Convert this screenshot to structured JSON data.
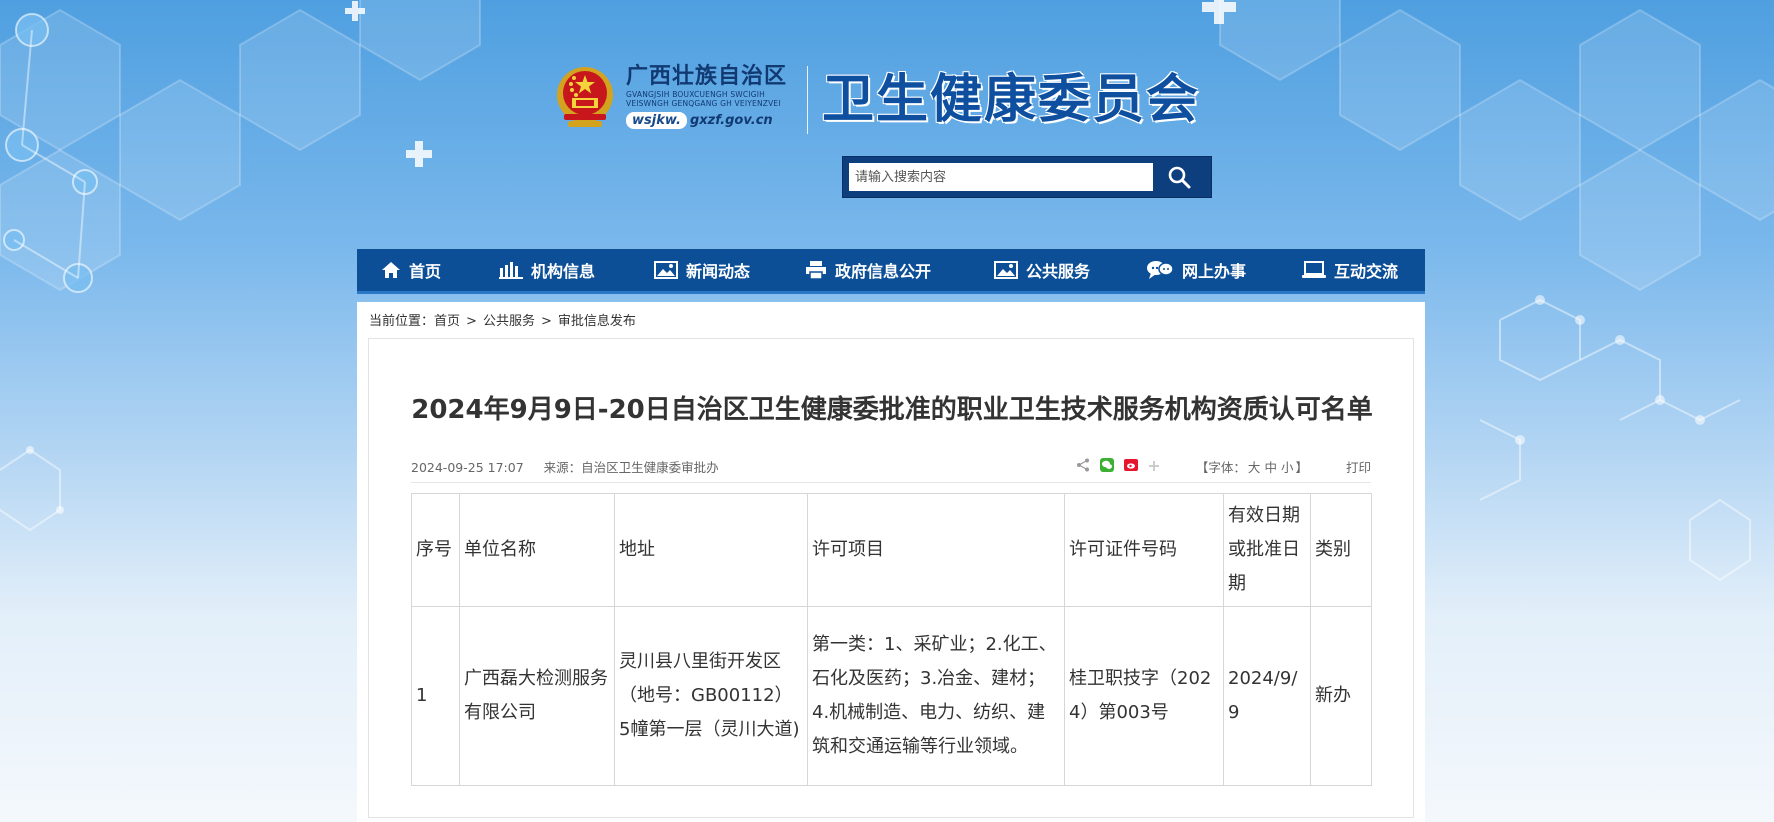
{
  "header": {
    "region_name": "广西壮族自治区",
    "region_name_latin_1": "GVANGJSIH BOUXCUENGH SWCIGIH",
    "region_name_latin_2": "VEISWNGH GENQGANG GH VEIYENZVEI",
    "domain_prefix": "wsjkw.",
    "domain_rest": "gxzf.gov.cn",
    "site_title": "卫生健康委员会"
  },
  "search": {
    "placeholder": "请输入搜索内容",
    "icon": "search-icon"
  },
  "nav": {
    "items": [
      {
        "label": "首页",
        "icon": "home-icon"
      },
      {
        "label": "机构信息",
        "icon": "bar-chart-icon"
      },
      {
        "label": "新闻动态",
        "icon": "image-icon"
      },
      {
        "label": "政府信息公开",
        "icon": "printer-icon"
      },
      {
        "label": "公共服务",
        "icon": "image-icon"
      },
      {
        "label": "网上办事",
        "icon": "chat-bubbles-icon"
      },
      {
        "label": "互动交流",
        "icon": "laptop-icon"
      }
    ]
  },
  "breadcrumb": {
    "prefix": "当前位置：",
    "items": [
      "首页",
      "公共服务",
      "审批信息发布"
    ],
    "separator": ">"
  },
  "article": {
    "title": "2024年9月9日-20日自治区卫生健康委批准的职业卫生技术服务机构资质认可名单",
    "date": "2024-09-25 17:07",
    "source": "来源：自治区卫生健康委审批办",
    "share_icons": [
      "share-icon",
      "wechat-icon",
      "weibo-icon",
      "plus-icon"
    ],
    "font_size": {
      "label_open": "【字体：",
      "large": "大",
      "medium": "中",
      "small": "小",
      "label_close": "】"
    },
    "print_label": "打印"
  },
  "table": {
    "headers": [
      "序号",
      "单位名称",
      "地址",
      "许可项目",
      "许可证件号码",
      "有效日期或批准日期",
      "类别"
    ],
    "rows": [
      [
        "1",
        "广西磊大检测服务有限公司",
        "灵川县八里街开发区（地号：GB00112）5幢第一层（灵川大道)",
        "第一类：1、采矿业；2.化工、石化及医药；3.冶金、建材；4.机械制造、电力、纺织、建筑和交通运输等行业领域。",
        "桂卫职技字（2024）第003号",
        "2024/9/9",
        "新办"
      ]
    ]
  },
  "colors": {
    "nav_bg": "#0d4f97",
    "title_blue": "#0e4fa0",
    "search_bg": "#0d3f7e"
  }
}
